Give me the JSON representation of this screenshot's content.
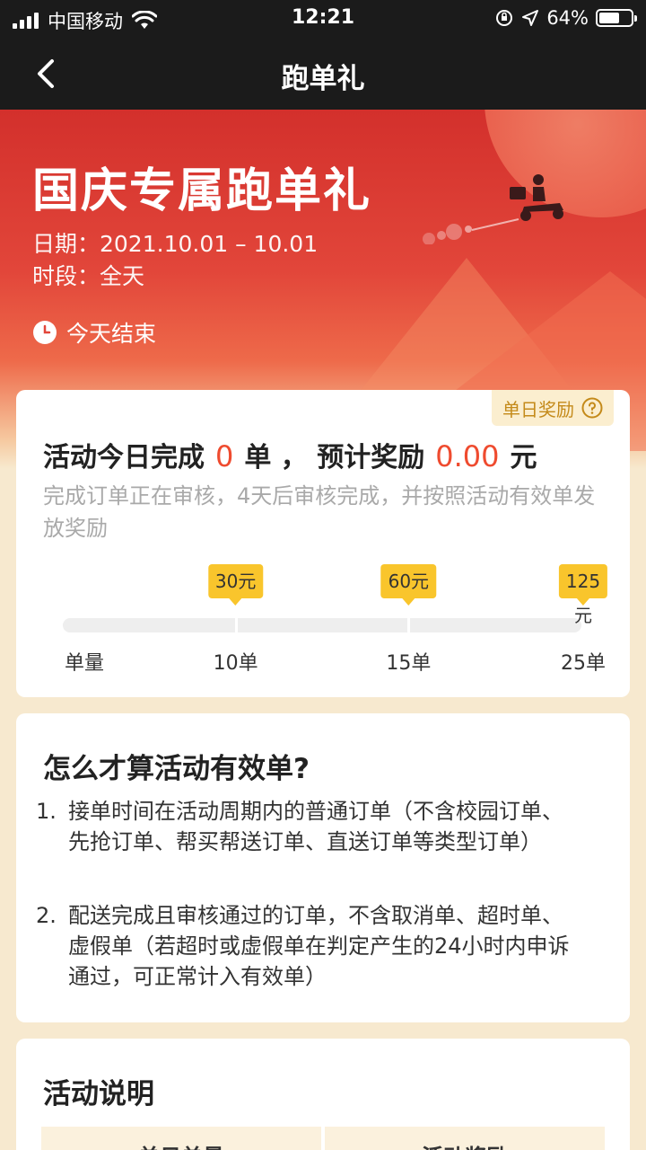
{
  "status_bar": {
    "carrier": "中国移动",
    "time": "12:21",
    "battery": "64%",
    "battery_level": 0.64,
    "icons": [
      "signal-icon",
      "wifi-icon",
      "rotation-lock-icon",
      "location-icon",
      "battery-icon"
    ]
  },
  "nav": {
    "title": "跑单礼",
    "back_icon": "chevron-left-icon"
  },
  "hero": {
    "title": "国庆专属跑单礼",
    "date": "日期：2021.10.01 – 10.01",
    "period": "时段：全天",
    "end_text": "今天结束",
    "icons": [
      "clock-icon",
      "scooter-rider-icon"
    ]
  },
  "progress_card": {
    "reward_tag": "单日奖励",
    "summary_prefix": "活动今日完成",
    "completed": "0",
    "summary_mid": "单 ， 预计奖励",
    "reward_amount": "0.00",
    "summary_suffix": "元",
    "note": "完成订单正在审核，4天后审核完成，并按照活动有效单发放奖励",
    "progress_value": 0,
    "axis_label": "单量",
    "milestones": [
      {
        "orders": 10,
        "label": "10单",
        "reward": "30元"
      },
      {
        "orders": 15,
        "label": "15单",
        "reward": "60元"
      },
      {
        "orders": 25,
        "label": "25单",
        "reward": "125元"
      }
    ]
  },
  "valid_card": {
    "title": "怎么才算活动有效单?",
    "rules": [
      {
        "index": "1.",
        "text": "接单时间在活动周期内的普通订单（不含校园订单、先抢订单、帮买帮送订单、直送订单等类型订单）"
      },
      {
        "index": "2.",
        "text": "配送完成且审核通过的订单，不含取消单、超时单、虚假单（若超时或虚假单在判定产生的24小时内申诉通过，可正常计入有效单）"
      }
    ]
  },
  "desc_card": {
    "title": "活动说明",
    "columns": [
      "单日单量",
      "活动奖励"
    ]
  },
  "colors": {
    "accent_red": "#ef4b2f",
    "bubble_yellow": "#f9c52c",
    "hero_red": "#d3302c",
    "tag_text": "#c48a1a"
  }
}
